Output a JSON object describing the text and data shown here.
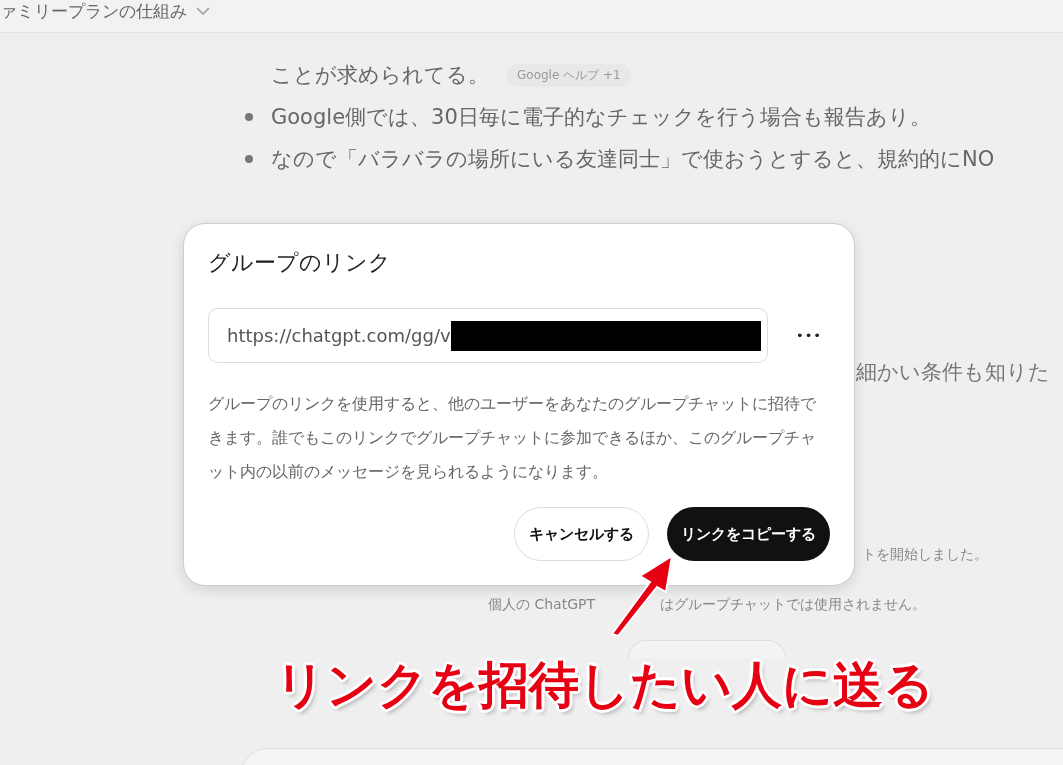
{
  "header": {
    "title": "ァミリープランの仕組み"
  },
  "bullets": [
    {
      "text": "ことが求められてる。",
      "chip": "Google ヘルプ +1",
      "marker": false
    },
    {
      "text": "Google側では、30日毎に電子的なチェックを行う場合も報告あり。",
      "marker": true
    },
    {
      "text": "なので「バラバラの場所にいる友達同士」で使おうとすると、規約的にNO",
      "marker": true
    }
  ],
  "partial_text": "細かい条件も知りた",
  "notices": [
    "トを開始しました。",
    "個人の ChatGPT",
    "はグループチャットでは使用されません。"
  ],
  "dialog": {
    "title": "グループのリンク",
    "link": "https://chatgpt.com/gg/v",
    "more": "•••",
    "description": "グループのリンクを使用すると、他のユーザーをあなたのグループチャットに招待できます。誰でもこのリンクでグループチャットに参加できるほか、このグループチャット内の以前のメッセージを見られるようになります。",
    "cancel": "キャンセルする",
    "copy": "リンクをコピーする"
  },
  "annotation": "リンクを招待したい人に送る"
}
